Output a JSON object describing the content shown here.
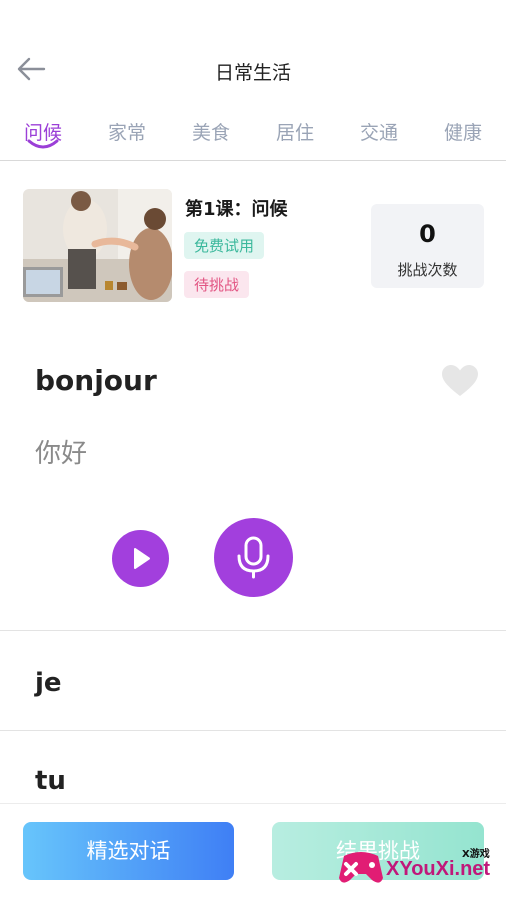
{
  "header": {
    "title": "日常生活"
  },
  "tabs": [
    {
      "label": "问候",
      "active": true
    },
    {
      "label": "家常",
      "active": false
    },
    {
      "label": "美食",
      "active": false
    },
    {
      "label": "居住",
      "active": false
    },
    {
      "label": "交通",
      "active": false
    },
    {
      "label": "健康",
      "active": false
    }
  ],
  "lesson": {
    "title": "第1课：问候",
    "tag_free": "免费试用",
    "tag_status": "待挑战",
    "challenge_count": "0",
    "challenge_label": "挑战次数"
  },
  "current_word": {
    "word": "bonjour",
    "translation": "你好"
  },
  "word_list": [
    {
      "word": "je"
    },
    {
      "word": "tu"
    }
  ],
  "buttons": {
    "dialog": "精选对话",
    "challenge": "结果挑战"
  },
  "watermark": {
    "text": "XYouXi.net",
    "small": "X游戏"
  },
  "colors": {
    "accent": "#a23fdd",
    "tab_inactive": "#9aa4b6",
    "free_tag": "#3bb89c",
    "status_tag": "#e25583"
  }
}
